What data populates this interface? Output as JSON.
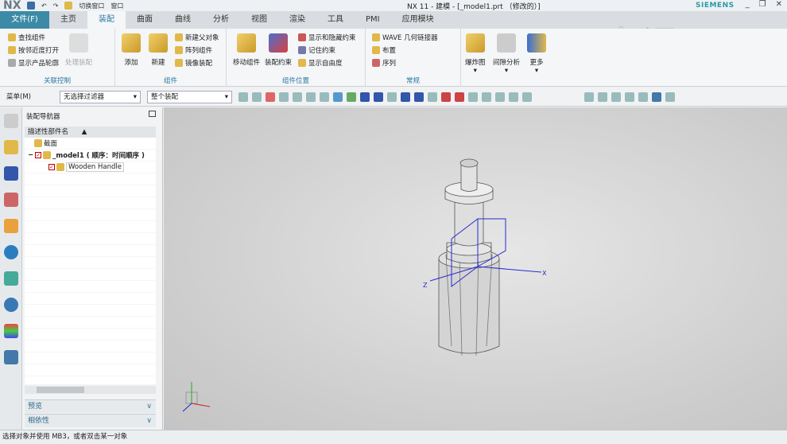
{
  "titlebar": {
    "logo": "NX",
    "switch_window": "切换窗口",
    "window_menu": "窗口",
    "title": "NX 11 - 建模 - [_model1.prt （修改的）]",
    "brand": "SIEMENS"
  },
  "tabs": [
    "文件(F)",
    "主页",
    "装配",
    "曲面",
    "曲线",
    "分析",
    "视图",
    "渲染",
    "工具",
    "PMI",
    "应用模块"
  ],
  "ribbon": {
    "g1": {
      "items": [
        "查找组件",
        "按邻近度打开",
        "显示产品轮廓"
      ],
      "big": "处理装配",
      "label": "关联控制"
    },
    "g2": {
      "big": [
        "添加",
        "新建"
      ],
      "items": [
        "新建父对象",
        "阵列组件",
        "镜像装配"
      ],
      "label": "组件"
    },
    "g3": {
      "big": [
        "移动组件",
        "装配约束"
      ],
      "items": [
        "显示和隐藏约束",
        "记住约束",
        "显示自由度"
      ],
      "label": "组件位置"
    },
    "g4": {
      "items": [
        "WAVE 几何链接器",
        "布置",
        "序列"
      ],
      "label": "常规"
    },
    "g5": {
      "big": [
        "爆炸图",
        "间隙分析",
        "更多"
      ]
    }
  },
  "toolbar": {
    "menu": "菜单(M)",
    "filter": "无选择过滤器",
    "scope": "整个装配"
  },
  "navigator": {
    "title": "装配导航器",
    "column": "描述性部件名",
    "nodes": [
      "截面",
      "_model1 ( 顺序：时间顺序 )",
      "Wooden Handle"
    ],
    "panels": [
      "预览",
      "相依性"
    ]
  },
  "viewport": {
    "axes": [
      "X",
      "Z"
    ],
    "watermark": "虎课网"
  },
  "status": "选择对象并使用 MB3，或者双击某一对象"
}
